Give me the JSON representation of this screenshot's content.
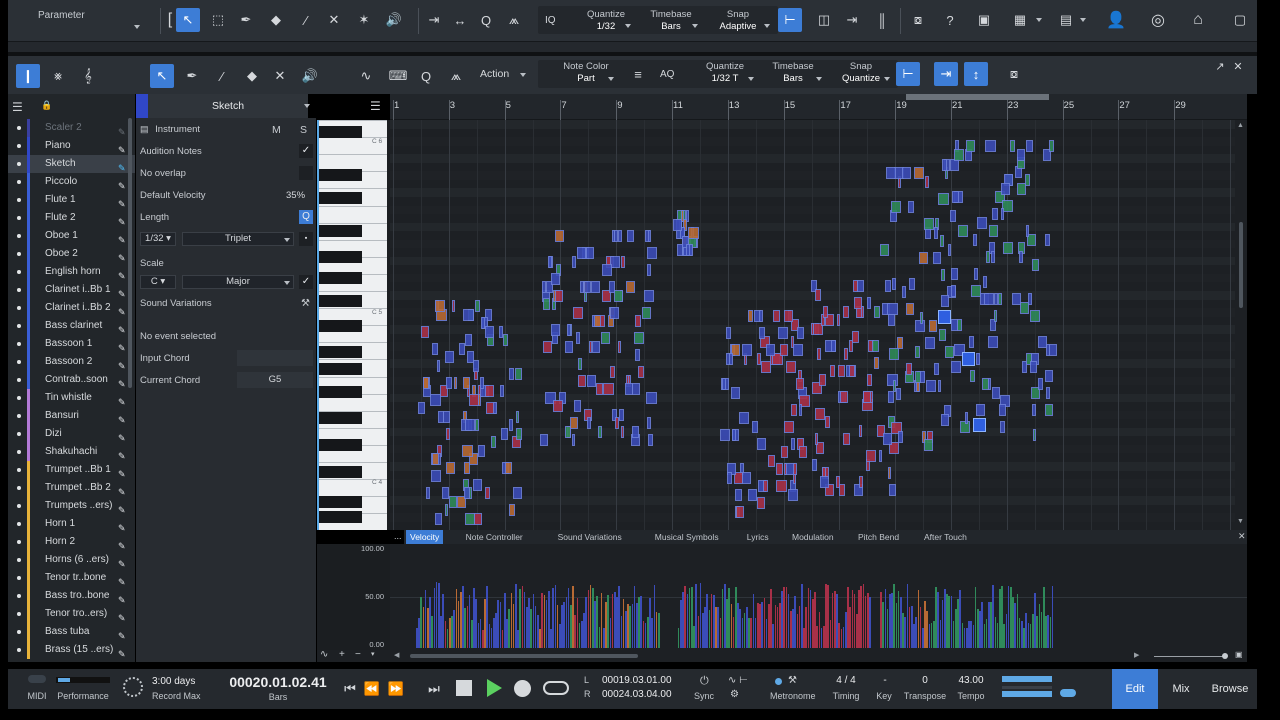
{
  "topbar": {
    "title": "Parameter",
    "quantize": {
      "label": "Quantize",
      "value": "1/32"
    },
    "timebase": {
      "label": "Timebase",
      "value": "Bars"
    },
    "snap": {
      "label": "Snap",
      "value": "Adaptive"
    },
    "iq": "IQ"
  },
  "editor_toolbar": {
    "action_label": "Action",
    "note_color": {
      "label": "Note Color",
      "value": "Part"
    },
    "aq": "AQ",
    "quantize": {
      "label": "Quantize",
      "value": "1/32 T"
    },
    "timebase": {
      "label": "Timebase",
      "value": "Bars"
    },
    "snap": {
      "label": "Snap",
      "value": "Quantize"
    }
  },
  "tracklist": {
    "header_title": "Sketch",
    "tracks": [
      {
        "name": "Scaler 2",
        "color": "#3a3fa0",
        "dim": true
      },
      {
        "name": "Piano",
        "color": "#3047c8"
      },
      {
        "name": "Sketch",
        "color": "#3047c8",
        "selected": true
      },
      {
        "name": "Piccolo",
        "color": "#3a5fd8"
      },
      {
        "name": "Flute 1",
        "color": "#3a5fd8"
      },
      {
        "name": "Flute 2",
        "color": "#3a5fd8"
      },
      {
        "name": "Oboe 1",
        "color": "#3a5fd8"
      },
      {
        "name": "Oboe 2",
        "color": "#3a5fd8"
      },
      {
        "name": "English horn",
        "color": "#3a5fd8"
      },
      {
        "name": "Clarinet i..Bb 1",
        "color": "#3a5fd8"
      },
      {
        "name": "Clarinet i..Bb 2",
        "color": "#3a5fd8"
      },
      {
        "name": "Bass clarinet",
        "color": "#3a5fd8"
      },
      {
        "name": "Bassoon 1",
        "color": "#3a5fd8"
      },
      {
        "name": "Bassoon 2",
        "color": "#3a5fd8"
      },
      {
        "name": "Contrab..soon",
        "color": "#3a5fd8"
      },
      {
        "name": "Tin whistle",
        "color": "#b47ad8"
      },
      {
        "name": "Bansuri",
        "color": "#b47ad8"
      },
      {
        "name": "Dizi",
        "color": "#b47ad8"
      },
      {
        "name": "Shakuhachi",
        "color": "#b47ad8"
      },
      {
        "name": "Trumpet ..Bb 1",
        "color": "#e8b33a"
      },
      {
        "name": "Trumpet ..Bb 2",
        "color": "#e8b33a"
      },
      {
        "name": "Trumpets ..ers)",
        "color": "#e8b33a"
      },
      {
        "name": "Horn 1",
        "color": "#e8b33a"
      },
      {
        "name": "Horn 2",
        "color": "#e8b33a"
      },
      {
        "name": "Horns (6 ..ers)",
        "color": "#e8b33a"
      },
      {
        "name": "Tenor tr..bone",
        "color": "#e8b33a"
      },
      {
        "name": "Bass tro..bone",
        "color": "#e8b33a"
      },
      {
        "name": "Tenor tro..ers)",
        "color": "#e8b33a"
      },
      {
        "name": "Bass tuba",
        "color": "#e8b33a"
      },
      {
        "name": "Brass (15 ..ers)",
        "color": "#e8b33a"
      }
    ]
  },
  "inspector": {
    "instrument": "Instrument",
    "m": "M",
    "s": "S",
    "audition_notes": "Audition Notes",
    "no_overlap": "No overlap",
    "default_velocity_label": "Default Velocity",
    "default_velocity_value": "35%",
    "length_label": "Length",
    "length_value": "1/32",
    "length_mode": "Triplet",
    "scale_label": "Scale",
    "scale_root": "C",
    "scale_type": "Major",
    "sound_variations": "Sound Variations",
    "no_event": "No event selected",
    "input_chord": "Input Chord",
    "current_chord_label": "Current Chord",
    "current_chord_value": "G5",
    "q": "Q"
  },
  "ruler": {
    "bars": [
      "1",
      "3",
      "5",
      "7",
      "9",
      "11",
      "13",
      "15",
      "17",
      "19",
      "21",
      "23",
      "25",
      "27",
      "29"
    ]
  },
  "piano": {
    "labels": [
      "C 6",
      "C 5",
      "C 4"
    ]
  },
  "lanes": {
    "tabs": [
      "Velocity",
      "Note Controller",
      "Sound Variations",
      "Musical Symbols",
      "Lyrics",
      "Modulation",
      "Pitch Bend",
      "After Touch"
    ],
    "active": "Velocity",
    "more": "...",
    "axis": [
      "100.00",
      "50.00",
      "0.00"
    ]
  },
  "transport": {
    "midi": "MIDI",
    "performance": "Performance",
    "record_max_value": "3:00 days",
    "record_max_label": "Record Max",
    "position": "00020.01.02.41",
    "position_unit": "Bars",
    "loop_l_label": "L",
    "loop_l": "00019.03.01.00",
    "loop_r_label": "R",
    "loop_r": "00024.03.04.00",
    "sync": "Sync",
    "metronome": "Metronome",
    "timing_value": "4 / 4",
    "timing_label": "Timing",
    "key_value": "-",
    "key_label": "Key",
    "transpose_value": "0",
    "transpose_label": "Transpose",
    "tempo_value": "43.00",
    "tempo_label": "Tempo",
    "edit": "Edit",
    "mix": "Mix",
    "browse": "Browse"
  },
  "colors": {
    "accent": "#3d7dd6",
    "note_blue": "#3b4cb8",
    "note_green": "#2f8a5a",
    "note_red": "#a83048",
    "note_orange": "#b86a34"
  }
}
